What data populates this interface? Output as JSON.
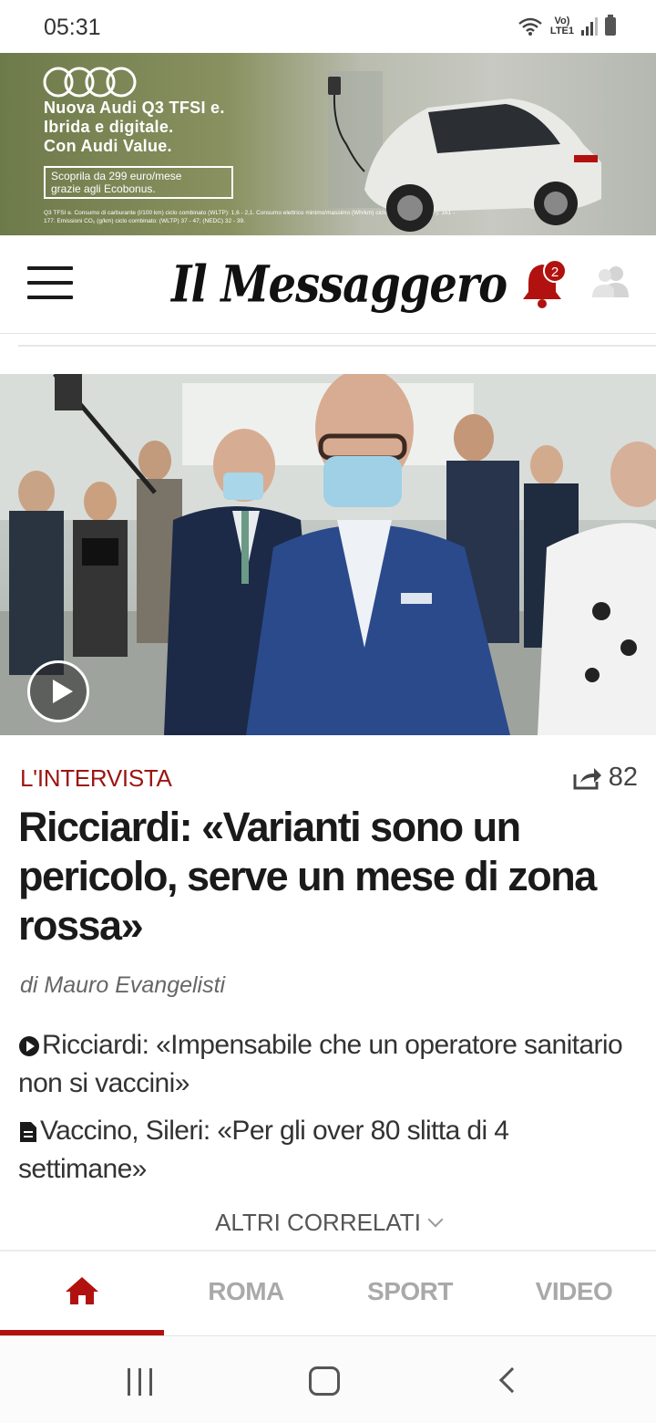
{
  "status_bar": {
    "time": "05:31",
    "network_label": "Vo)\nLTE1",
    "icons": [
      "wifi-icon",
      "signal-icon",
      "battery-icon"
    ]
  },
  "ad": {
    "brand_icon": "audi-rings-logo",
    "headline_lines": [
      "Nuova Audi Q3 TFSI e.",
      "Ibrida e digitale.",
      "Con Audi Value."
    ],
    "offer_lines": [
      "Scoprila da 299 euro/mese",
      "grazie agli Ecobonus."
    ],
    "fine_print": "Q3 TFSI e. Consumo di carburante (l/100 km) ciclo combinato (WLTP): 1,6 - 2,1. Consumo elettrico minimo/massimo (Wh/km) ciclo combinato (WLTP): 161 - 177. Emissioni CO₂ (g/km) ciclo combinato: (WLTP) 37 - 47; (NEDC) 32 - 39."
  },
  "header": {
    "logo_text": "Il Messaggero",
    "notification_count": "2",
    "icons": [
      "hamburger-menu-icon",
      "bell-icon",
      "user-icon"
    ]
  },
  "article": {
    "kicker": "L'INTERVISTA",
    "share_count": "82",
    "headline": "Ricciardi: «Varianti sono un pericolo, serve un mese di zona rossa»",
    "byline": "di Mauro Evangelisti",
    "related": [
      {
        "icon": "play-circle-icon",
        "text": "Ricciardi: «Impensabile che un operatore sanitario non si vaccini»"
      },
      {
        "icon": "document-icon",
        "text": "Vaccino, Sileri: «Per gli over 80 slitta di 4 settimane»"
      }
    ],
    "more_related": "ALTRI CORRELATI"
  },
  "tabs": [
    {
      "label": "",
      "icon": "home-icon",
      "active": true
    },
    {
      "label": "ROMA",
      "active": false
    },
    {
      "label": "SPORT",
      "active": false
    },
    {
      "label": "VIDEO",
      "active": false
    }
  ],
  "colors": {
    "accent_red": "#b1120f",
    "kicker_red": "#9c1512",
    "inactive_tab": "#a9a9a9"
  }
}
